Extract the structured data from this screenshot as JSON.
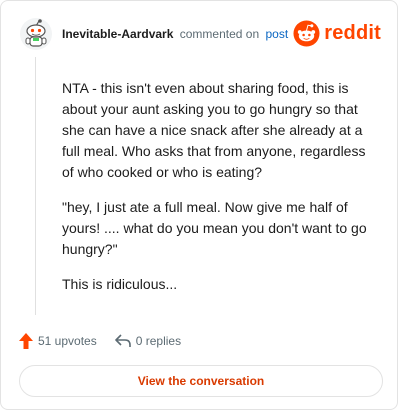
{
  "comment": {
    "author": "Inevitable-Aardvark",
    "action": "commented on",
    "post_link": "post",
    "paragraphs": [
      "NTA - this isn't even about sharing food, this is about your aunt asking you to go hungry so that she can have a nice snack after she already at a full meal. Who asks that from anyone, regardless of who cooked or who is eating?",
      "\"hey, I just ate a full meal. Now give me half of yours! .... what do you mean you don't want to go hungry?\"",
      "This is ridiculous..."
    ]
  },
  "brand": {
    "wordmark": "reddit",
    "color": "#ff4500"
  },
  "actions": {
    "upvotes": "51 upvotes",
    "replies": "0 replies"
  },
  "cta": {
    "label": "View the conversation"
  },
  "icons": {
    "avatar": "snoo-avatar-icon",
    "logo": "reddit-logo-icon",
    "upvote": "upvote-arrow-icon",
    "reply": "reply-arrow-icon"
  },
  "colors": {
    "accent": "#d93a00",
    "upvote": "#ff4500",
    "link": "#0a66c2"
  }
}
